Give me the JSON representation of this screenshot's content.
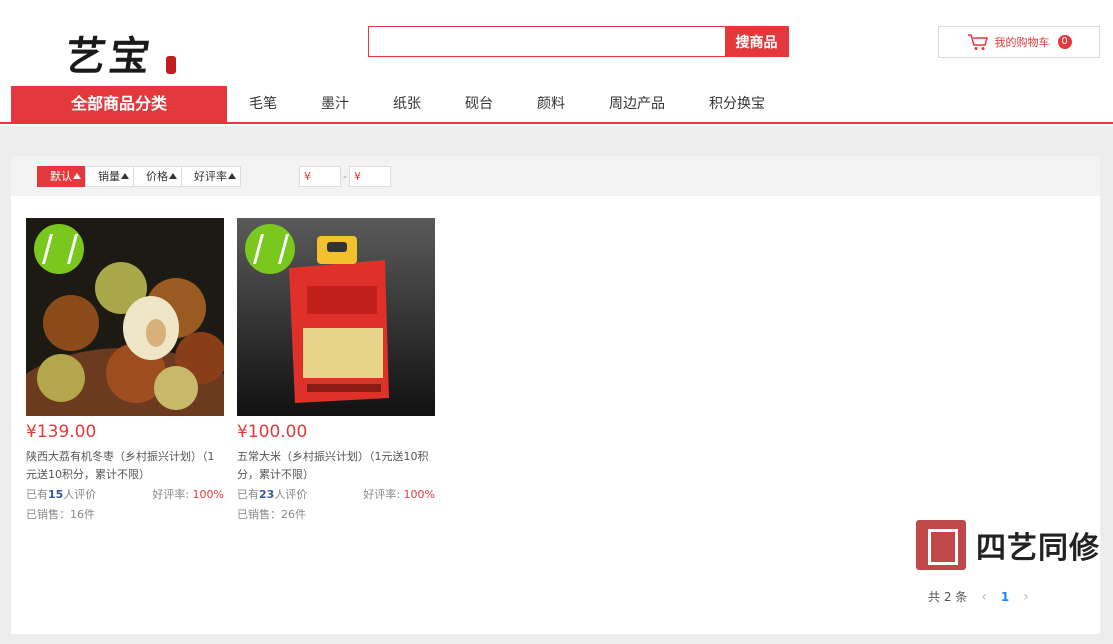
{
  "header": {
    "logo_text": "艺宝",
    "search": {
      "value": "",
      "placeholder": "",
      "button_label": "搜商品"
    },
    "cart": {
      "label": "我的购物车",
      "count": "0"
    }
  },
  "nav": {
    "all_categories": "全部商品分类",
    "items": [
      "毛笔",
      "墨汁",
      "纸张",
      "砚台",
      "颜料",
      "周边产品",
      "积分换宝"
    ]
  },
  "filters": {
    "sorts": [
      {
        "label": "默认",
        "active": true
      },
      {
        "label": "销量",
        "active": false
      },
      {
        "label": "价格",
        "active": false
      },
      {
        "label": "好评率",
        "active": false
      }
    ],
    "price_min_placeholder": "¥",
    "price_max_placeholder": "¥",
    "range_separator": "-"
  },
  "products": [
    {
      "price": "¥139.00",
      "title": "陕西大荔有机冬枣（乡村振兴计划）（1元送10积分，累计不限）",
      "reviews_prefix": "已有",
      "reviews_count": "15",
      "reviews_suffix": "人评价",
      "rating_label": "好评率:",
      "rating_value": "100%",
      "sold": "已销售：16件",
      "image": "jujube-photo"
    },
    {
      "price": "¥100.00",
      "title": "五常大米（乡村振兴计划）（1元送10积分，累计不限）",
      "reviews_prefix": "已有",
      "reviews_count": "23",
      "reviews_suffix": "人评价",
      "rating_label": "好评率:",
      "rating_value": "100%",
      "sold": "已销售：26件",
      "image": "rice-bag-photo"
    }
  ],
  "watermark": {
    "text": "四艺同修"
  },
  "pagination": {
    "total": "共 2 条",
    "current_page": "1",
    "prev": "‹",
    "next": "›"
  },
  "colors": {
    "accent": "#e4393c",
    "badge_green": "#7ac71e",
    "link_blue": "#1e88e5"
  }
}
